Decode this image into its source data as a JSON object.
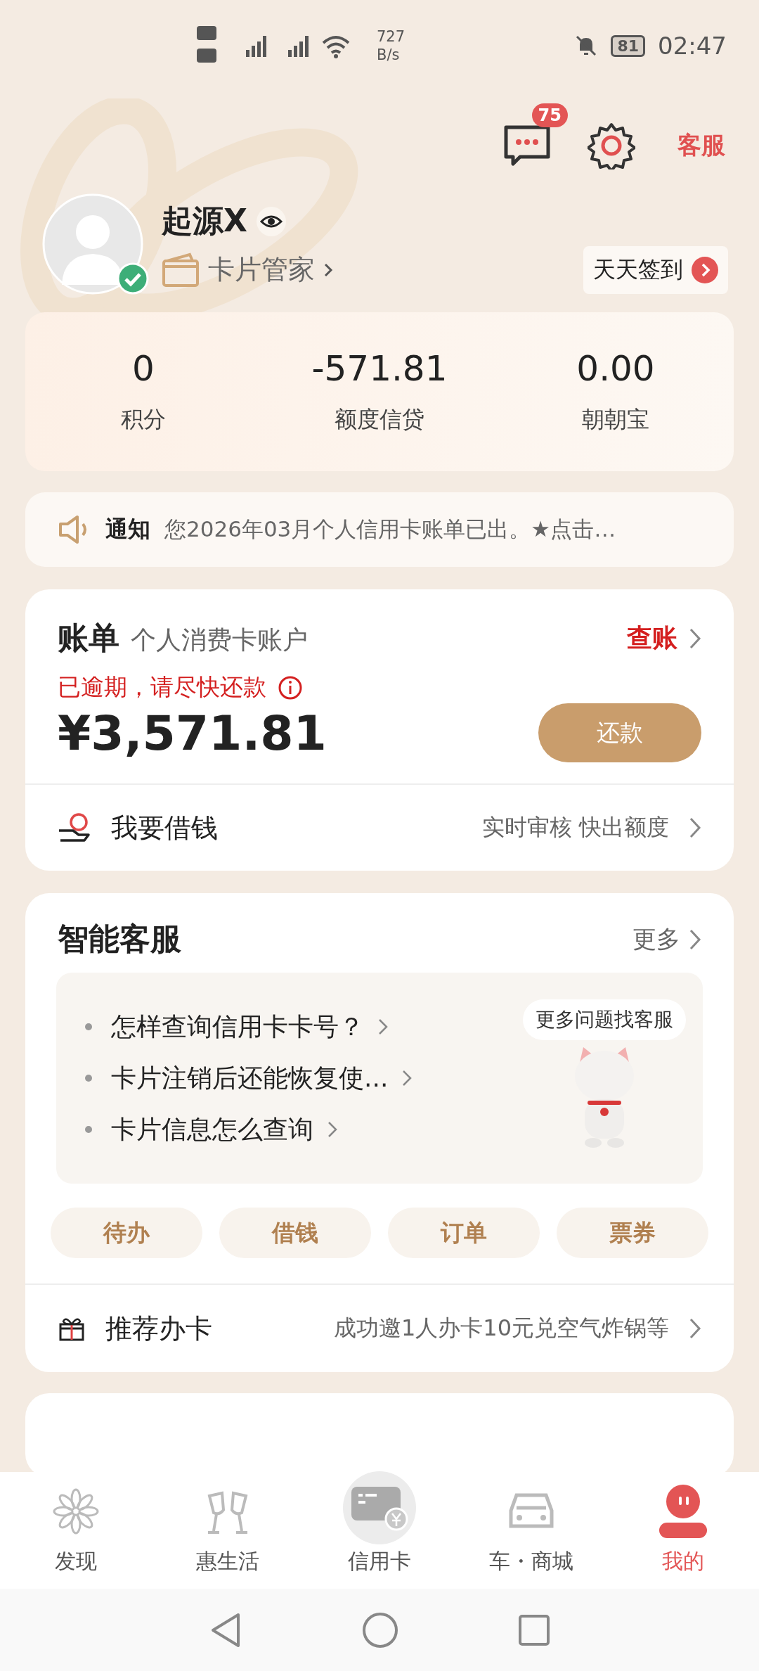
{
  "status_bar": {
    "network_speed": "727",
    "speed_unit": "B/s",
    "battery": "81",
    "time": "02:47"
  },
  "header": {
    "message_badge": "75",
    "service_link": "客服"
  },
  "profile": {
    "name": "起源X",
    "card_manager": "卡片管家",
    "checkin": "天天签到"
  },
  "stats": [
    {
      "value": "0",
      "label": "积分"
    },
    {
      "value": "-571.81",
      "label": "额度信贷"
    },
    {
      "value": "0.00",
      "label": "朝朝宝"
    }
  ],
  "notice": {
    "label": "通知",
    "text": "您2026年03月个人信用卡账单已出。★点击…"
  },
  "bill": {
    "title": "账单",
    "subtitle": "个人消费卡账户",
    "link": "查账",
    "warning": "已逾期，请尽快还款",
    "amount": "¥3,571.81",
    "pay_button": "还款"
  },
  "borrow": {
    "label": "我要借钱",
    "hint": "实时审核 快出额度"
  },
  "service": {
    "title": "智能客服",
    "more": "更多",
    "questions": [
      "怎样查询信用卡卡号？",
      "卡片注销后还能恢复使...",
      "卡片信息怎么查询"
    ],
    "bubble": "更多问题找客服",
    "chips": [
      "待办",
      "借钱",
      "订单",
      "票券"
    ]
  },
  "recommend": {
    "label": "推荐办卡",
    "hint": "成功邀1人办卡10元兑空气炸锅等"
  },
  "bottom_nav": [
    {
      "label": "发现",
      "selected": false
    },
    {
      "label": "惠生活",
      "selected": false
    },
    {
      "label": "信用卡",
      "selected": false
    },
    {
      "label": "车・商城",
      "selected": false
    },
    {
      "label": "我的",
      "selected": true
    }
  ]
}
